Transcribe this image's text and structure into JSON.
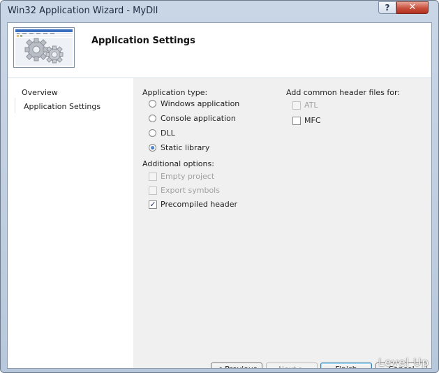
{
  "window": {
    "title": "Win32 Application Wizard - MyDll",
    "help_glyph": "?",
    "close_glyph": "✕"
  },
  "header": {
    "title": "Application Settings",
    "art_icon": "gears-window-icon"
  },
  "nav": {
    "items": [
      {
        "label": "Overview"
      },
      {
        "label": "Application Settings"
      }
    ]
  },
  "app_type": {
    "label": "Application type:",
    "options": [
      {
        "label": "Windows application",
        "selected": false
      },
      {
        "label": "Console application",
        "selected": false
      },
      {
        "label": "DLL",
        "selected": false
      },
      {
        "label": "Static library",
        "selected": true
      }
    ]
  },
  "additional": {
    "label": "Additional options:",
    "options": [
      {
        "label": "Empty project",
        "checked": false,
        "enabled": false
      },
      {
        "label": "Export symbols",
        "checked": false,
        "enabled": false
      },
      {
        "label": "Precompiled header",
        "checked": true,
        "enabled": true
      }
    ]
  },
  "headers": {
    "label": "Add common header files for:",
    "options": [
      {
        "label": "ATL",
        "checked": false,
        "enabled": false
      },
      {
        "label": "MFC",
        "checked": false,
        "enabled": true
      }
    ]
  },
  "buttons": {
    "previous": "< Previous",
    "next": "Next >",
    "finish": "Finish",
    "cancel": "Cancel"
  },
  "check_glyph": "✓",
  "watermark": "Level Up",
  "colors": {
    "accent": "#1e4f9c",
    "close": "#c7503c",
    "panel": "#f0f0f0"
  }
}
